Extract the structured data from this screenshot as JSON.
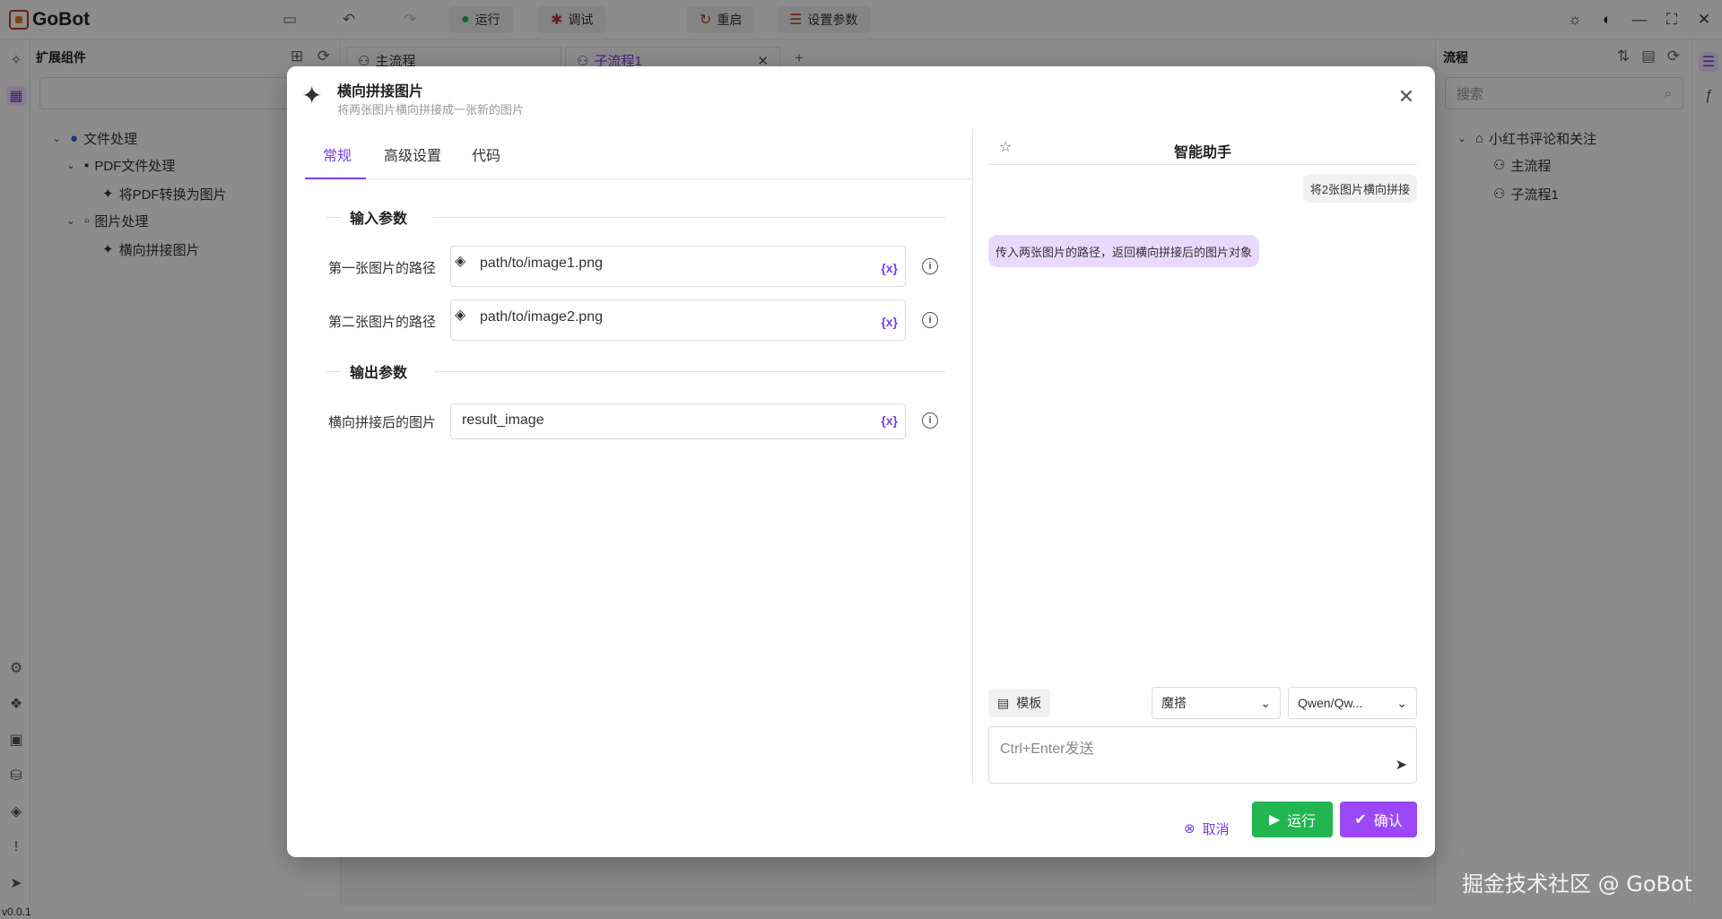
{
  "app": {
    "name": "GoBot",
    "version": "v0.0.1"
  },
  "toolbar": {
    "run_label": "运行",
    "debug_label": "调试",
    "restart_label": "重启",
    "settings_label": "设置参数"
  },
  "left_panel": {
    "title": "扩展组件",
    "tree": [
      {
        "label": "文件处理"
      },
      {
        "label": "PDF文件处理"
      },
      {
        "label": "将PDF转换为图片"
      },
      {
        "label": "图片处理"
      },
      {
        "label": "横向拼接图片"
      }
    ]
  },
  "tabs": [
    {
      "label": "主流程"
    },
    {
      "label": "子流程1"
    }
  ],
  "right_panel": {
    "title": "流程",
    "search_placeholder": "搜索",
    "tree": [
      {
        "label": "小红书评论和关注"
      },
      {
        "label": "主流程"
      },
      {
        "label": "子流程1"
      }
    ]
  },
  "modal": {
    "title": "横向拼接图片",
    "subtitle": "将两张图片横向拼接成一张新的图片",
    "tabs": [
      {
        "label": "常规"
      },
      {
        "label": "高级设置"
      },
      {
        "label": "代码"
      }
    ],
    "input_section": "输入参数",
    "output_section": "输出参数",
    "inputs": [
      {
        "label": "第一张图片的路径",
        "value": "path/to/image1.png"
      },
      {
        "label": "第二张图片的路径",
        "value": "path/to/image2.png"
      }
    ],
    "outputs": [
      {
        "label": "横向拼接后的图片",
        "value": "result_image"
      }
    ],
    "var_token": "{x}",
    "assistant": {
      "title": "智能助手",
      "user_message": "将2张图片横向拼接",
      "bot_message": "传入两张图片的路径，返回横向拼接后的图片对象",
      "template_label": "模板",
      "provider_value": "魔搭",
      "model_value": "Qwen/Qw...",
      "input_placeholder": "Ctrl+Enter发送"
    },
    "footer": {
      "cancel_label": "取消",
      "run_label": "运行",
      "confirm_label": "确认"
    }
  },
  "watermark": "掘金技术社区 @ GoBot",
  "colors": {
    "accent": "#7b3fe4",
    "run_green": "#21b64f",
    "confirm_purple": "#9c47f5"
  }
}
